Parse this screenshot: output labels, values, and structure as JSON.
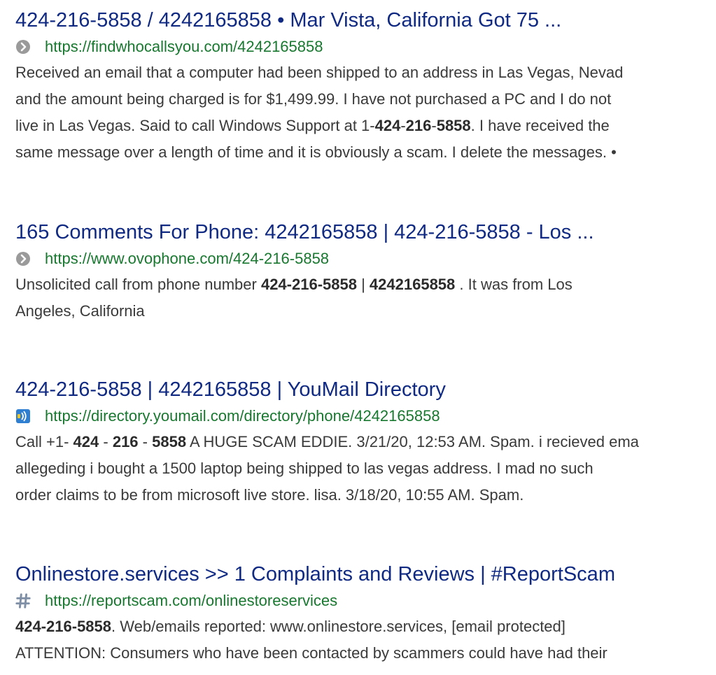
{
  "results": [
    {
      "title": "424-216-5858 / 4242165858 • Mar Vista, California Got 75 ...",
      "url": "https://findwhocallsyou.com/4242165858",
      "favicon": "gray-chevron-icon",
      "snippet_lines": [
        [
          {
            "t": "Received an email that a computer had been shipped to an address in Las Vegas, Nevad",
            "b": false
          }
        ],
        [
          {
            "t": "and the amount being charged is for $1,499.99. I have not purchased a PC and I do not",
            "b": false
          }
        ],
        [
          {
            "t": "live in Las Vegas. Said to call Windows Support at 1-",
            "b": false
          },
          {
            "t": "424",
            "b": true
          },
          {
            "t": "-",
            "b": false
          },
          {
            "t": "216",
            "b": true
          },
          {
            "t": "-",
            "b": false
          },
          {
            "t": "5858",
            "b": true
          },
          {
            "t": ". I have received the",
            "b": false
          }
        ],
        [
          {
            "t": "same message over a length of time and it is obviously a scam. I delete the messages. •",
            "b": false
          }
        ]
      ]
    },
    {
      "title": "165 Comments For Phone: 4242165858 | 424-216-5858 - Los ...",
      "url": "https://www.ovophone.com/424-216-5858",
      "favicon": "gray-chevron-icon",
      "snippet_lines": [
        [
          {
            "t": "Unsolicited call from phone number ",
            "b": false
          },
          {
            "t": "424-216-5858",
            "b": true
          },
          {
            "t": " | ",
            "b": false
          },
          {
            "t": "4242165858",
            "b": true
          },
          {
            "t": " . It was from Los",
            "b": false
          }
        ],
        [
          {
            "t": "Angeles, California",
            "b": false
          }
        ]
      ]
    },
    {
      "title": "424-216-5858 | 4242165858 | YouMail Directory",
      "url": "https://directory.youmail.com/directory/phone/4242165858",
      "favicon": "youmail-icon",
      "snippet_lines": [
        [
          {
            "t": "Call +1- ",
            "b": false
          },
          {
            "t": "424",
            "b": true
          },
          {
            "t": " - ",
            "b": false
          },
          {
            "t": "216",
            "b": true
          },
          {
            "t": " - ",
            "b": false
          },
          {
            "t": "5858",
            "b": true
          },
          {
            "t": " A HUGE SCAM EDDIE. 3/21/20, 12:53 AM. Spam. i recieved ema",
            "b": false
          }
        ],
        [
          {
            "t": "allegeding i bought a 1500 laptop being shipped to las vegas address. I mad no such",
            "b": false
          }
        ],
        [
          {
            "t": "order claims to be from microsoft live store. lisa. 3/18/20, 10:55 AM. Spam.",
            "b": false
          }
        ]
      ]
    },
    {
      "title": "Onlinestore.services >> 1 Complaints and Reviews | #ReportScam",
      "url": "https://reportscam.com/onlinestoreservices",
      "favicon": "hashtag-icon",
      "snippet_lines": [
        [
          {
            "t": "424-216-5858",
            "b": true
          },
          {
            "t": ". Web/emails reported: www.onlinestore.services, [email protected]",
            "b": false
          }
        ],
        [
          {
            "t": "ATTENTION: Consumers who have been contacted by scammers could have had their",
            "b": false
          }
        ]
      ]
    }
  ],
  "colors": {
    "title": "#102a83",
    "url": "#18782f",
    "snippet": "#3a3a3a"
  }
}
